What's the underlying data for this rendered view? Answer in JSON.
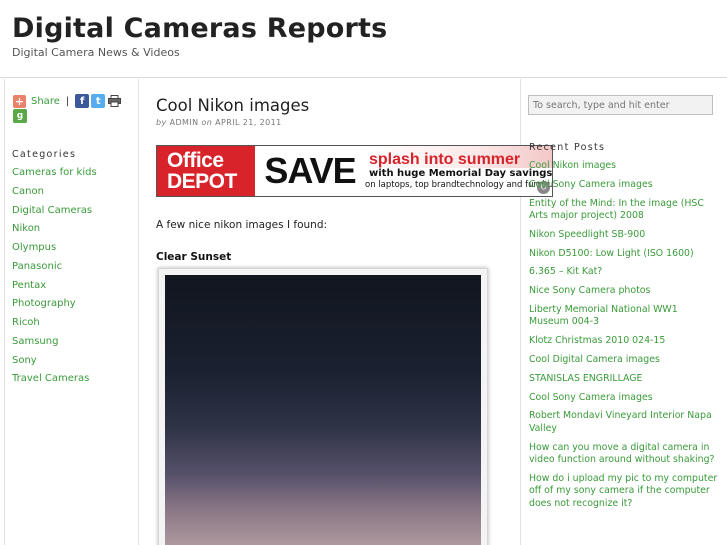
{
  "site": {
    "title": "Digital Cameras Reports",
    "description": "Digital Camera News & Videos"
  },
  "share": {
    "label": "Share",
    "separator": "|",
    "icons": [
      "share-plus-icon",
      "facebook-icon",
      "twitter-icon",
      "print-icon",
      "google-icon"
    ]
  },
  "categories": {
    "title": "Categories",
    "items": [
      "Cameras for kids",
      "Canon",
      "Digital Cameras",
      "Nikon",
      "Olympus",
      "Panasonic",
      "Pentax",
      "Photography",
      "Ricoh",
      "Samsung",
      "Sony",
      "Travel Cameras"
    ]
  },
  "post": {
    "title": "Cool Nikon images",
    "by": "by",
    "author": "ADMIN",
    "on": "on",
    "date": "APRIL 21, 2011",
    "intro": "A few nice nikon images I found:",
    "image_caption": "Clear Sunset"
  },
  "ad": {
    "brand_line1": "Office",
    "brand_line2": "DEPOT",
    "save": "SAVE",
    "splash": "splash into summer",
    "memorial": "with huge Memorial Day savings",
    "laptops": "on laptops, top brandtechnology and furniture"
  },
  "search": {
    "placeholder": "To search, type and hit enter"
  },
  "recent_posts": {
    "title": "Recent Posts",
    "items": [
      "Cool Nikon images",
      "Cool Sony Camera images",
      "Entity of the Mind: In the image (HSC Arts major project) 2008",
      "Nikon Speedlight SB-900",
      "Nikon D5100: Low Light (ISO 1600)",
      "6.365 – Kit Kat?",
      "Nice Sony Camera photos",
      "Liberty Memorial National WW1 Museum 004-3",
      "Klotz Christmas 2010 024-15",
      "Cool Digital Camera images",
      "STANISLAS ENGRILLAGE",
      "Cool Sony Camera images",
      "Robert Mondavi Vineyard Interior Napa Valley",
      "How can you move a digital camera in video function around without shaking?",
      "How do i upload my pic to my computer off of my sony camera if the computer does not recognize it?"
    ]
  },
  "colors": {
    "link": "#3a9b3a",
    "ad_red": "#d8232a"
  }
}
